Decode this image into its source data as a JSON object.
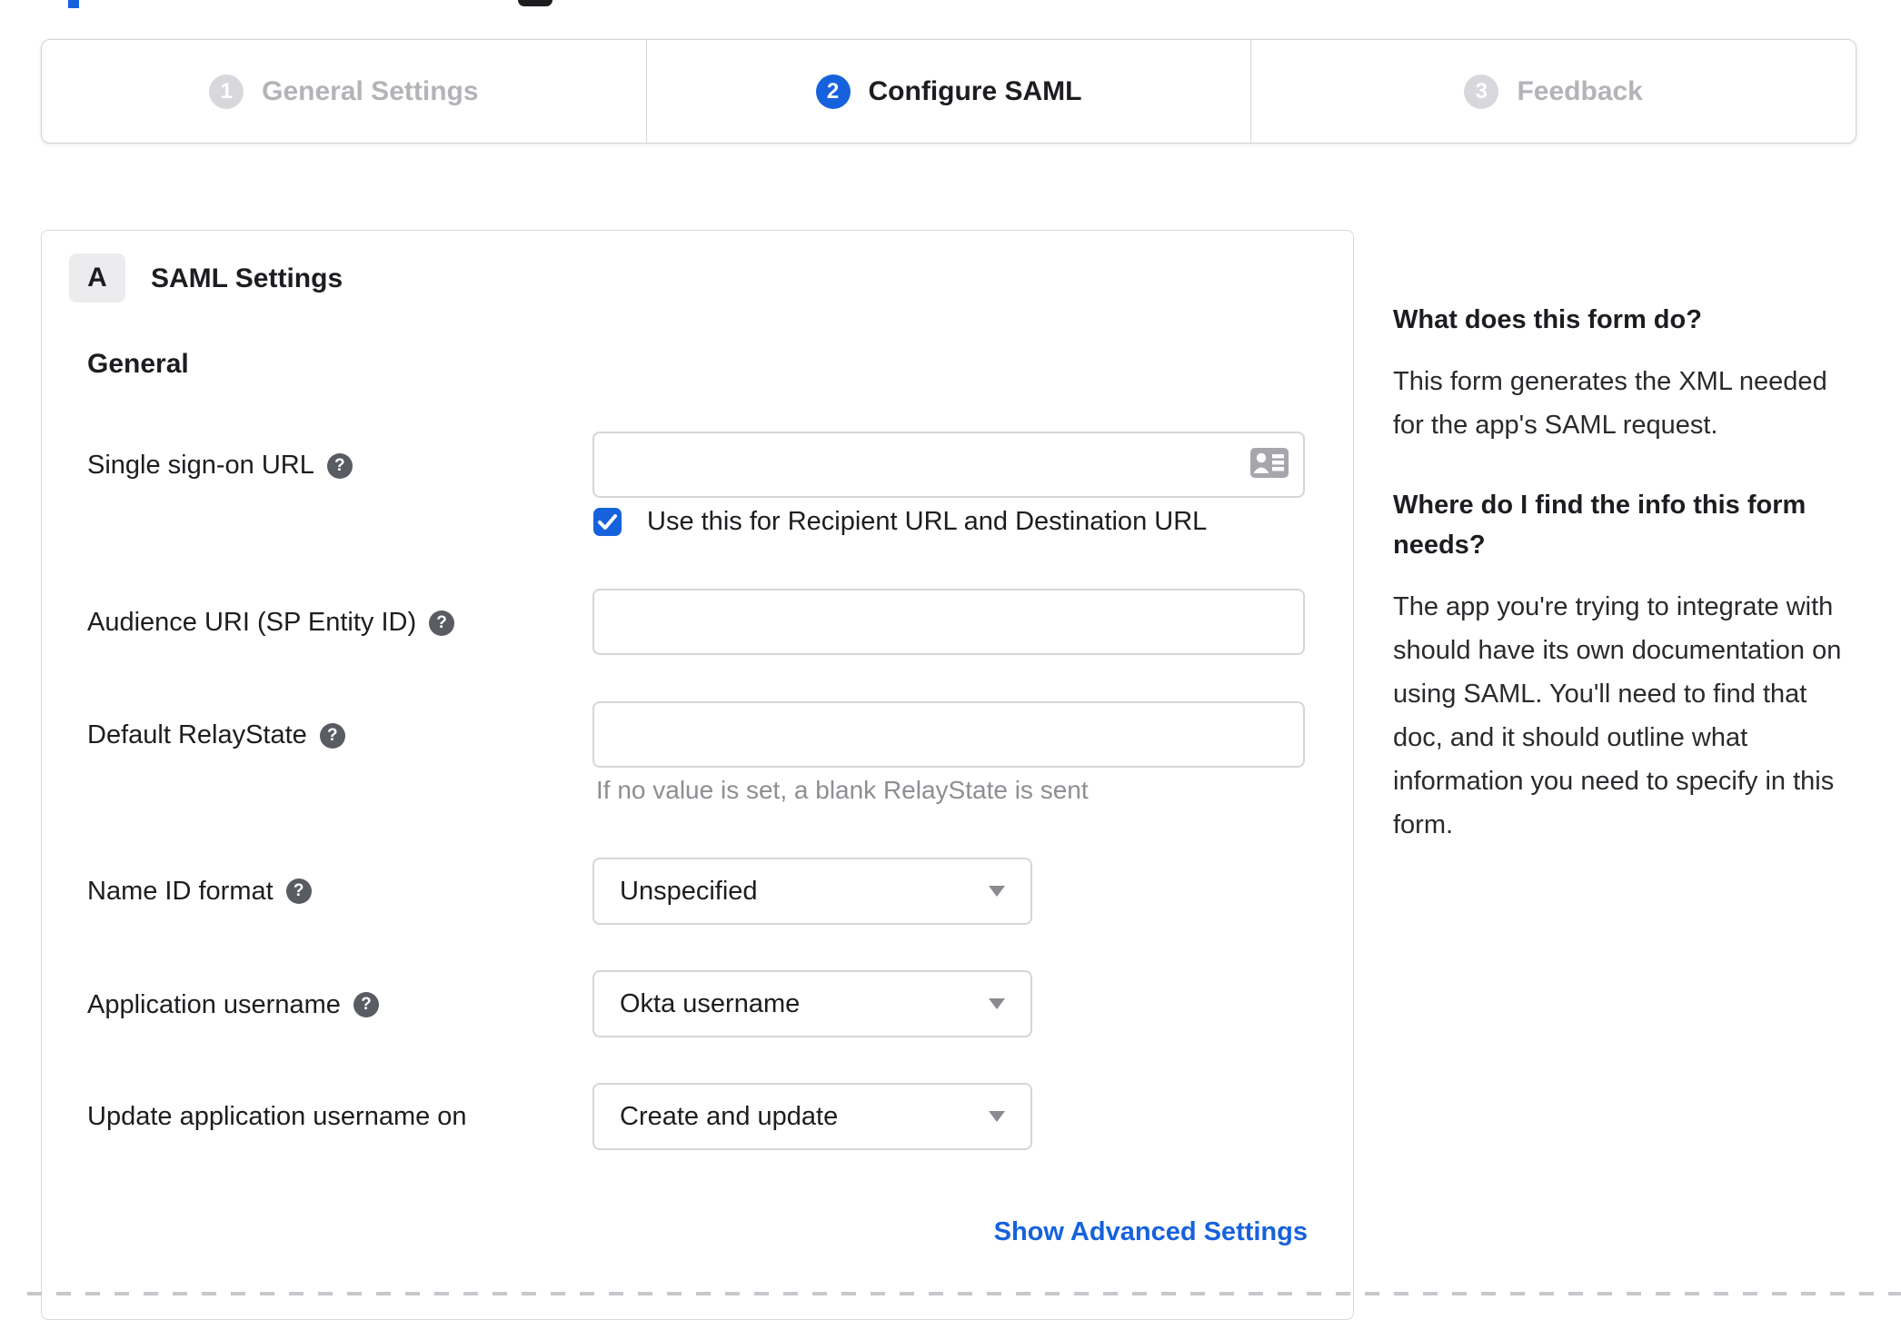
{
  "colors": {
    "accent_blue": "#1662dd",
    "text_dark": "#1d1d21",
    "muted_gray": "#8e8e93",
    "border_gray": "#d6d6da",
    "inactive_step_gray": "#d8d8dc"
  },
  "stepper": {
    "steps": [
      {
        "number": "1",
        "label": "General Settings",
        "state": "inactive"
      },
      {
        "number": "2",
        "label": "Configure SAML",
        "state": "active"
      },
      {
        "number": "3",
        "label": "Feedback",
        "state": "inactive"
      }
    ]
  },
  "panel": {
    "section_badge": "A",
    "section_title": "SAML Settings",
    "group_heading": "General",
    "advanced_link": "Show Advanced Settings"
  },
  "form": {
    "sso": {
      "label": "Single sign-on URL",
      "value": "",
      "checkbox_label": "Use this for Recipient URL and Destination URL",
      "checked": true
    },
    "audience": {
      "label": "Audience URI (SP Entity ID)",
      "value": ""
    },
    "relay": {
      "label": "Default RelayState",
      "value": "",
      "helper": "If no value is set, a blank RelayState is sent"
    },
    "name_id": {
      "label": "Name ID format",
      "value": "Unspecified"
    },
    "app_username": {
      "label": "Application username",
      "value": "Okta username"
    },
    "update_username": {
      "label": "Update application username on",
      "value": "Create and update"
    }
  },
  "sidebar": {
    "q1": "What does this form do?",
    "a1": "This form generates the XML needed for the app's SAML request.",
    "q2": "Where do I find the info this form needs?",
    "a2": "The app you're trying to integrate with should have its own documentation on using SAML. You'll need to find that doc, and it should outline what information you need to specify in this form."
  }
}
